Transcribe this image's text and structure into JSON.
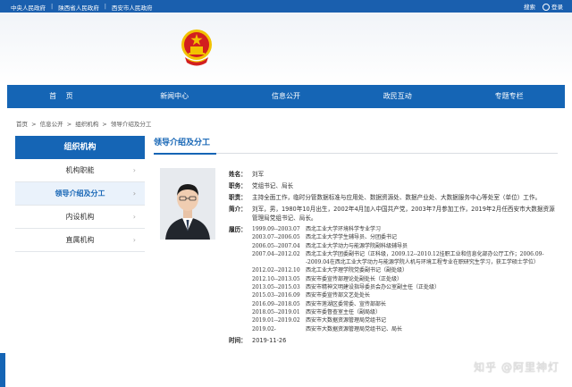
{
  "topbar": {
    "links": [
      "中央人民政府",
      "陕西省人民政府",
      "西安市人民政府"
    ],
    "separator": "|",
    "search_label": "搜索",
    "login_label": "登录"
  },
  "colors": {
    "brand_blue": "#1565b5",
    "top_blue": "#1a5fae",
    "emblem_red": "#d21f1f",
    "emblem_gold": "#f2c200"
  },
  "nav": [
    "首 页",
    "新闻中心",
    "信息公开",
    "政民互动",
    "专题专栏"
  ],
  "breadcrumb": [
    "首页",
    ">",
    "信息公开",
    ">",
    "组织机构",
    ">",
    "领导介绍及分工"
  ],
  "sidebar": {
    "title": "组织机构",
    "items": [
      "机构职能",
      "领导介绍及分工",
      "内设机构",
      "直属机构"
    ]
  },
  "main": {
    "title": "领导介绍及分工",
    "labels": {
      "name": "姓名：",
      "position": "职务：",
      "duty": "职责：",
      "intro": "简介：",
      "resume": "履历：",
      "time": "时间："
    },
    "name": "刘军",
    "position": "党组书记、局长",
    "duty": "主持全面工作，临时分管数据标准与应用处、数据资源处、数据产业处、大数据服务中心等处室（单位）工作。",
    "intro": "刘军，男，1980年10月出生，2002年4月加入中国共产党，2003年7月参加工作，2019年2月任西安市大数据资源管理局党组书记、局长。",
    "resume": [
      {
        "period": "1999.09--2003.07",
        "desc": "西北工业大学环境科学专业学习"
      },
      {
        "period": "2003.07--2006.05",
        "desc": "西北工业大学学生辅导员、分团委书记"
      },
      {
        "period": "2006.05--2007.04",
        "desc": "西北工业大学动力与能源学院副科级辅导员"
      },
      {
        "period": "2007.04--2012.02",
        "desc": "西北工业大学团委副书记（正科级，2009.12--2010.12挂职工业和信息化部办公厅工作；2006.09--2009.04在西北工业大学动力与能源学院人机与环境工程专业在职研究生学习，获工学硕士学位）"
      },
      {
        "period": "2012.02--2012.10",
        "desc": "西北工业大学理学院党委副书记（副处级）"
      },
      {
        "period": "2012.10--2013.05",
        "desc": "西安市委宣传部理论处副处长（正处级）"
      },
      {
        "period": "2013.05--2015.03",
        "desc": "西安市精神文明建设指导委员会办公室副主任（正处级）"
      },
      {
        "period": "2015.03--2016.09",
        "desc": "西安市委宣传部文艺处处长"
      },
      {
        "period": "2016.09--2018.05",
        "desc": "西安市莲湖区委常委、宣传部部长"
      },
      {
        "period": "2018.05--2019.01",
        "desc": "西安市委督查室主任（副局级）"
      },
      {
        "period": "2019.01--2019.02",
        "desc": "西安市大数据资源管理局党组书记"
      },
      {
        "period": "2019.02-",
        "desc": "西安市大数据资源管理局党组书记、局长"
      }
    ],
    "time": "2019-11-26"
  },
  "watermark": "知乎 @阿里神灯"
}
